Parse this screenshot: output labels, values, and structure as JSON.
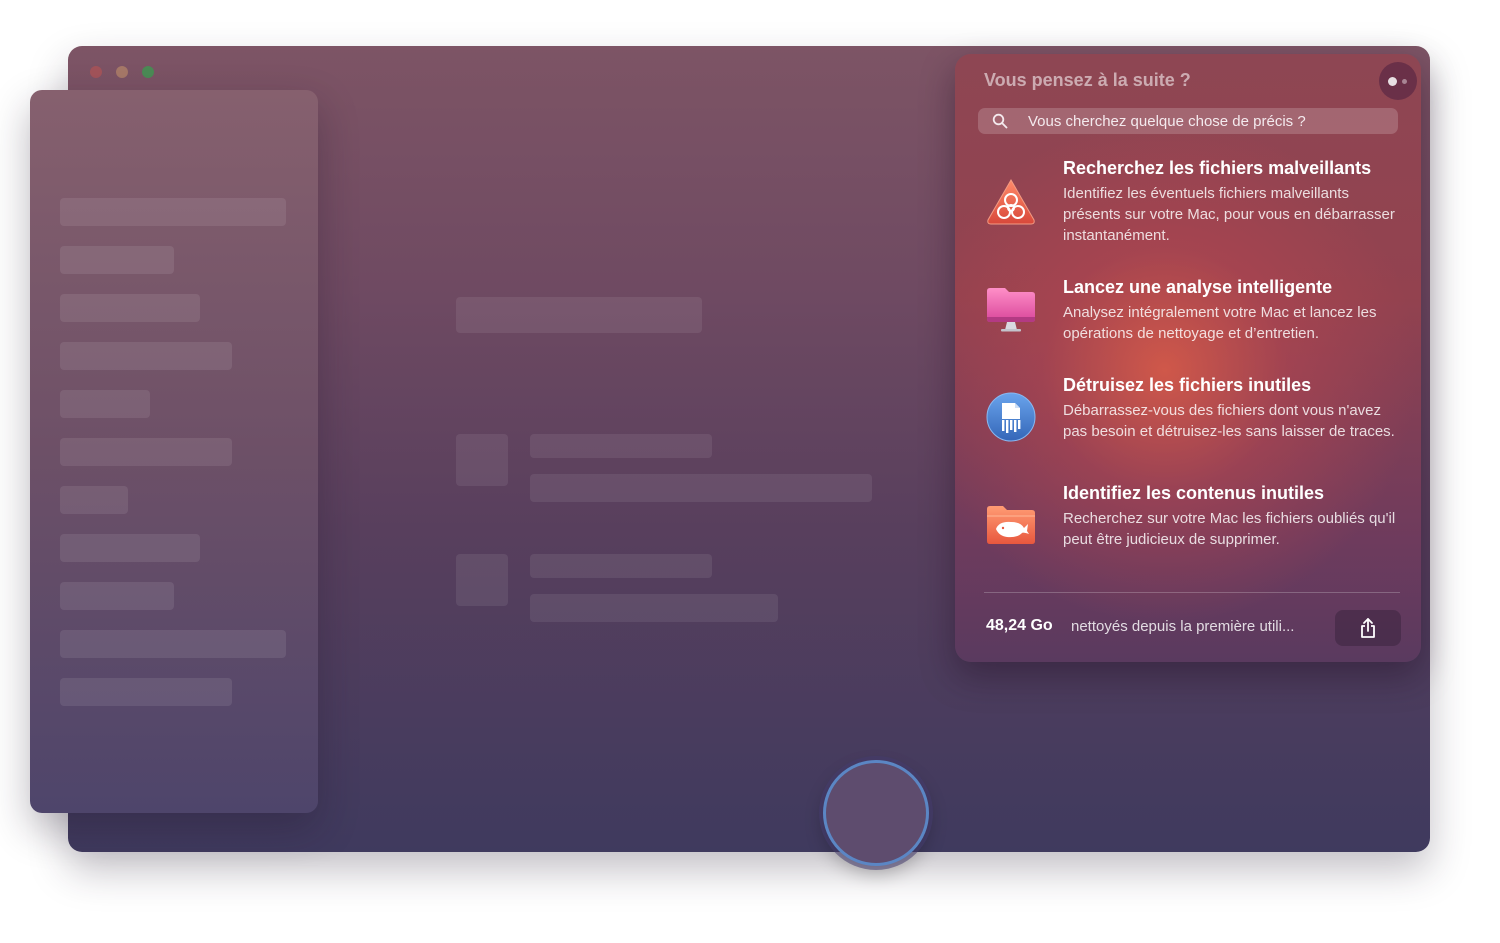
{
  "panel": {
    "title": "Vous pensez à la suite ?",
    "search_placeholder": "Vous cherchez quelque chose de précis ?",
    "items": [
      {
        "icon": "biohazard-icon",
        "title": "Recherchez les fichiers malveillants",
        "description": "Identifiez les éventuels fichiers malveillants présents sur votre Mac, pour vous en débarrasser instantanément."
      },
      {
        "icon": "imac-icon",
        "title": "Lancez une analyse intelligente",
        "description": "Analysez intégralement votre Mac et lancez les opérations de nettoyage et d’entretien."
      },
      {
        "icon": "shredder-icon",
        "title": "Détruisez les fichiers inutiles",
        "description": "Débarrassez-vous des fichiers dont vous n'avez pas besoin et détruisez-les sans laisser de traces."
      },
      {
        "icon": "whale-folder-icon",
        "title": "Identifiez les contenus inutiles",
        "description": "Recherchez sur votre Mac les fichiers oubliés qu'il peut être judicieux de supprimer."
      }
    ],
    "footer": {
      "amount": "48,24 Go",
      "text": "nettoyés depuis la première utili..."
    }
  },
  "colors": {
    "window_top": "#7d5465",
    "window_bottom": "#3f3a5e",
    "panel_accent": "#93424f",
    "scan_ring": "#5b86c4"
  }
}
